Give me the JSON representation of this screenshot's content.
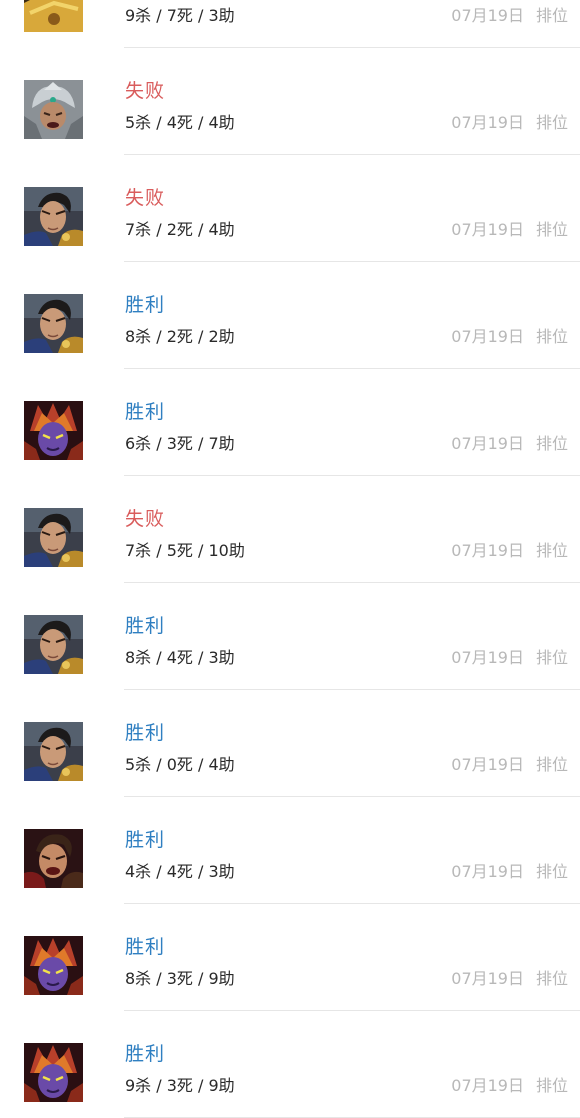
{
  "colors": {
    "win": "#2f7fc1",
    "loss": "#d95c5c",
    "meta_text": "#b8b8b8",
    "kda_text": "#2a2a2a",
    "divider": "#e6e6e6"
  },
  "matches": [
    {
      "hero_icon": "gold-armored-hero-portrait",
      "result": "",
      "outcome": "win",
      "kda": "9杀 / 7死 / 3助",
      "date": "07月19日",
      "mode": "排位"
    },
    {
      "hero_icon": "silver-helmet-warrior-portrait",
      "result": "失败",
      "outcome": "loss",
      "kda": "5杀 / 4死 / 4助",
      "date": "07月19日",
      "mode": "排位"
    },
    {
      "hero_icon": "dark-haired-swordsman-portrait",
      "result": "失败",
      "outcome": "loss",
      "kda": "7杀 / 2死 / 4助",
      "date": "07月19日",
      "mode": "排位"
    },
    {
      "hero_icon": "dark-haired-swordsman-portrait",
      "result": "胜利",
      "outcome": "win",
      "kda": "8杀 / 2死 / 2助",
      "date": "07月19日",
      "mode": "排位"
    },
    {
      "hero_icon": "purple-demon-hero-portrait",
      "result": "胜利",
      "outcome": "win",
      "kda": "6杀 / 3死 / 7助",
      "date": "07月19日",
      "mode": "排位"
    },
    {
      "hero_icon": "dark-haired-swordsman-portrait",
      "result": "失败",
      "outcome": "loss",
      "kda": "7杀 / 5死 / 10助",
      "date": "07月19日",
      "mode": "排位"
    },
    {
      "hero_icon": "dark-haired-swordsman-portrait",
      "result": "胜利",
      "outcome": "win",
      "kda": "8杀 / 4死 / 3助",
      "date": "07月19日",
      "mode": "排位"
    },
    {
      "hero_icon": "dark-haired-swordsman-portrait",
      "result": "胜利",
      "outcome": "win",
      "kda": "5杀 / 0死 / 4助",
      "date": "07月19日",
      "mode": "排位"
    },
    {
      "hero_icon": "shouting-warrior-portrait",
      "result": "胜利",
      "outcome": "win",
      "kda": "4杀 / 4死 / 3助",
      "date": "07月19日",
      "mode": "排位"
    },
    {
      "hero_icon": "purple-demon-hero-portrait",
      "result": "胜利",
      "outcome": "win",
      "kda": "8杀 / 3死 / 9助",
      "date": "07月19日",
      "mode": "排位"
    },
    {
      "hero_icon": "purple-demon-hero-portrait",
      "result": "胜利",
      "outcome": "win",
      "kda": "9杀 / 3死 / 9助",
      "date": "07月19日",
      "mode": "排位"
    }
  ]
}
